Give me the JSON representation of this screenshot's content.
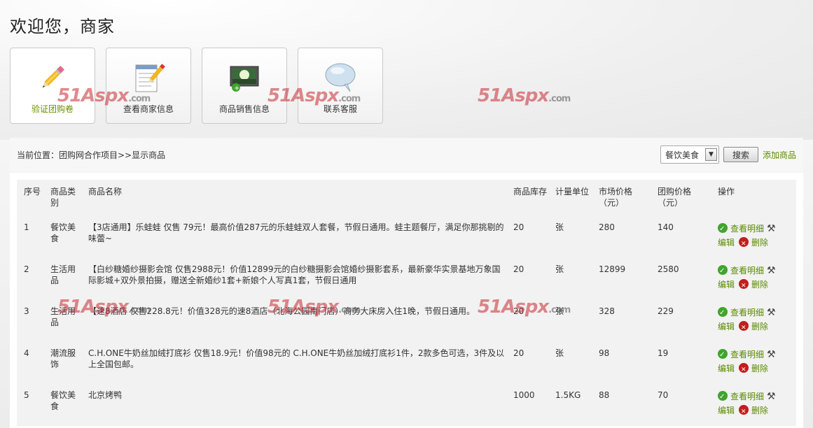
{
  "header": {
    "welcome": "欢迎您，商家"
  },
  "tiles": [
    {
      "label": "验证团购卷",
      "icon": "pencil-icon"
    },
    {
      "label": "查看商家信息",
      "icon": "notepad-edit-icon"
    },
    {
      "label": "商品销售信息",
      "icon": "monitor-image-icon"
    },
    {
      "label": "联系客服",
      "icon": "speech-bubble-icon"
    }
  ],
  "watermark": {
    "brand": "51Aspx",
    "domain": ".com"
  },
  "toolbar": {
    "breadcrumb": "当前位置：团购网合作项目>>显示商品",
    "category_selected": "餐饮美食",
    "search_label": "搜索",
    "add_label": "添加商品"
  },
  "table": {
    "headers": [
      "序号",
      "商品类别",
      "商品名称",
      "商品库存",
      "计量单位",
      "市场价格（元）",
      "团购价格（元）",
      "操作"
    ],
    "ops": {
      "view": "查看明细",
      "edit": "编辑",
      "delete": "删除"
    },
    "rows": [
      {
        "no": "1",
        "category": "餐饮美食",
        "name": "【3店通用】乐蛙蛙 仅售 79元！最高价值287元的乐蛙蛙双人套餐，节假日通用。蛙主题餐厅，满足你那挑剔的味蕾~",
        "stock": "20",
        "unit": "张",
        "market": "280",
        "group": "140"
      },
      {
        "no": "2",
        "category": "生活用品",
        "name": "【白纱糖婚纱摄影会馆 仅售2988元！价值12899元的白纱糖摄影会馆婚纱摄影套系，最新豪华实景基地万象国际影城+双外景拍摄，赠送全新婚纱1套+新娘个人写真1套，节假日通用",
        "stock": "20",
        "unit": "张",
        "market": "12899",
        "group": "2580"
      },
      {
        "no": "3",
        "category": "生活用品",
        "name": "【速8酒店 仅售228.8元！价值328元的速8酒店（北海公园南门店）商务大床房入住1晚，节假日通用。",
        "stock": "20",
        "unit": "张",
        "market": "328",
        "group": "229"
      },
      {
        "no": "4",
        "category": "潮流服饰",
        "name": "C.H.ONE牛奶丝加绒打底衫 仅售18.9元！价值98元的 C.H.ONE牛奶丝加绒打底衫1件，2款多色可选，3件及以上全国包邮。",
        "stock": "20",
        "unit": "张",
        "market": "98",
        "group": "19"
      },
      {
        "no": "5",
        "category": "餐饮美食",
        "name": "北京烤鸭",
        "stock": "1000",
        "unit": "1.5KG",
        "market": "88",
        "group": "70"
      }
    ]
  }
}
